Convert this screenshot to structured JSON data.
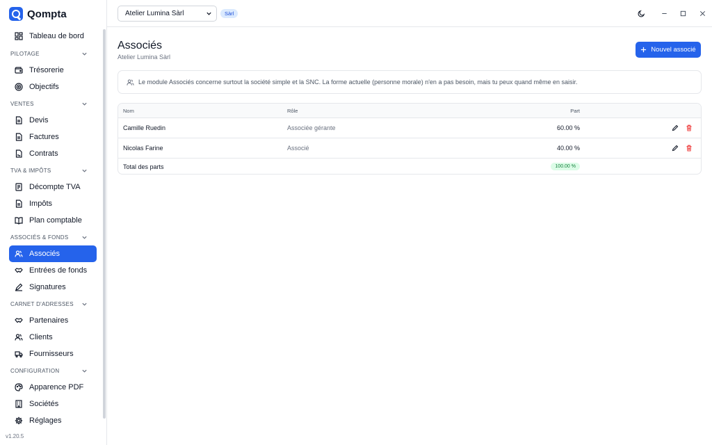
{
  "app": {
    "name": "Qompta",
    "version": "v1.20.5"
  },
  "sidebar": {
    "dashboard": "Tableau de bord",
    "sections": [
      {
        "title": "PILOTAGE",
        "items": [
          {
            "label": "Trésorerie",
            "icon": "wallet-icon"
          },
          {
            "label": "Objectifs",
            "icon": "target-icon"
          }
        ]
      },
      {
        "title": "VENTES",
        "items": [
          {
            "label": "Devis",
            "icon": "document-icon"
          },
          {
            "label": "Factures",
            "icon": "document-icon"
          },
          {
            "label": "Contrats",
            "icon": "contract-icon"
          }
        ]
      },
      {
        "title": "TVA & IMPÔTS",
        "items": [
          {
            "label": "Décompte TVA",
            "icon": "receipt-icon"
          },
          {
            "label": "Impôts",
            "icon": "document-icon"
          },
          {
            "label": "Plan comptable",
            "icon": "book-icon"
          }
        ]
      },
      {
        "title": "ASSOCIÉS & FONDS",
        "items": [
          {
            "label": "Associés",
            "icon": "users-icon",
            "active": true
          },
          {
            "label": "Entrées de fonds",
            "icon": "handshake-icon"
          },
          {
            "label": "Signatures",
            "icon": "pen-icon"
          }
        ]
      },
      {
        "title": "CARNET D'ADRESSES",
        "items": [
          {
            "label": "Partenaires",
            "icon": "handshake-icon"
          },
          {
            "label": "Clients",
            "icon": "users-icon"
          },
          {
            "label": "Fournisseurs",
            "icon": "truck-icon"
          }
        ]
      },
      {
        "title": "CONFIGURATION",
        "items": [
          {
            "label": "Apparence PDF",
            "icon": "palette-icon"
          },
          {
            "label": "Sociétés",
            "icon": "building-icon"
          },
          {
            "label": "Réglages",
            "icon": "gear-icon"
          }
        ]
      }
    ]
  },
  "topbar": {
    "company": "Atelier Lumina Sàrl",
    "company_type": "Sàrl"
  },
  "page": {
    "title": "Associés",
    "subtitle": "Atelier Lumina Sàrl",
    "new_button": "Nouvel associé",
    "info": "Le module Associés concerne surtout la société simple et la SNC. La forme actuelle (personne morale) n'en a pas besoin, mais tu peux quand même en saisir."
  },
  "table": {
    "columns": {
      "name": "Nom",
      "role": "Rôle",
      "part": "Part"
    },
    "rows": [
      {
        "name": "Camille Ruedin",
        "role": "Associée gérante",
        "part": "60.00 %"
      },
      {
        "name": "Nicolas Farine",
        "role": "Associé",
        "part": "40.00 %"
      }
    ],
    "total_label": "Total des parts",
    "total_value": "100.00 %"
  },
  "colors": {
    "accent": "#2563eb",
    "delete": "#ef4444",
    "success_bg": "#dcfce7",
    "success_text": "#15803d"
  }
}
